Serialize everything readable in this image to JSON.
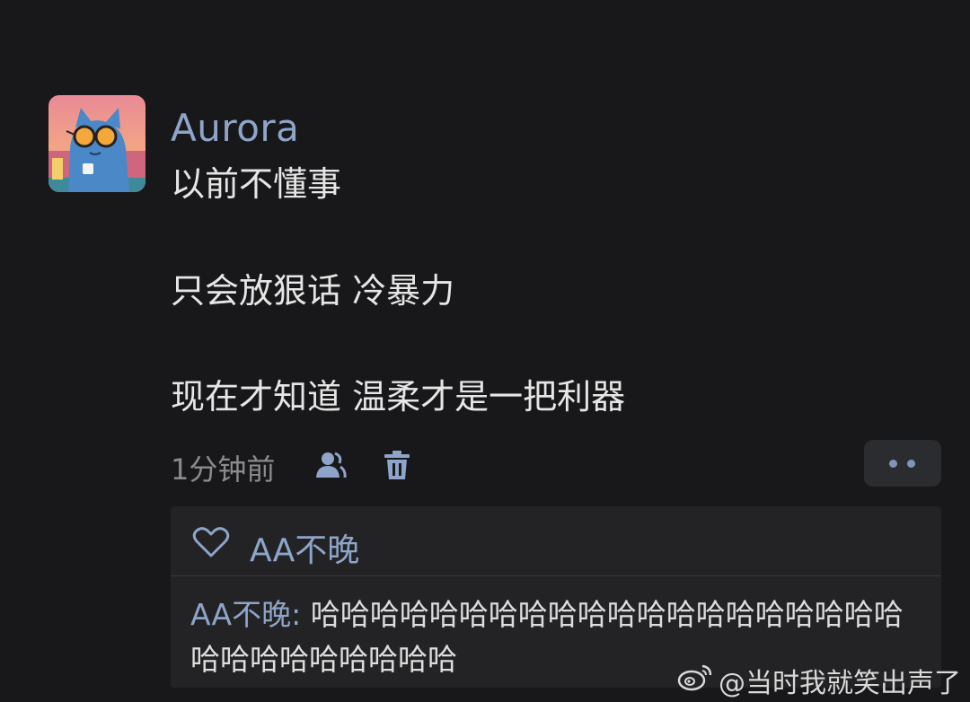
{
  "post": {
    "author": "Aurora",
    "lines": [
      "以前不懂事",
      "只会放狠话 冷暴力",
      "现在才知道 温柔才是一把利器"
    ],
    "time": "1分钟前",
    "icons": {
      "visibility": "friends-visibility-icon",
      "delete": "trash-icon",
      "more": "more-dots-icon"
    }
  },
  "interactions": {
    "like_icon": "heart-icon",
    "likers": "AA不晚",
    "reply": {
      "author": "AA不晚",
      "separator": ": ",
      "text": "哈哈哈哈哈哈哈哈哈哈哈哈哈哈哈哈哈哈哈哈哈哈哈哈哈哈哈哈哈"
    }
  },
  "watermark": {
    "icon": "weibo-logo",
    "text": "@当时我就笑出声了"
  },
  "colors": {
    "background": "#18181a",
    "accent_name": "#8ea5c9",
    "body_text": "#e6e6e6",
    "panel": "#232325"
  }
}
